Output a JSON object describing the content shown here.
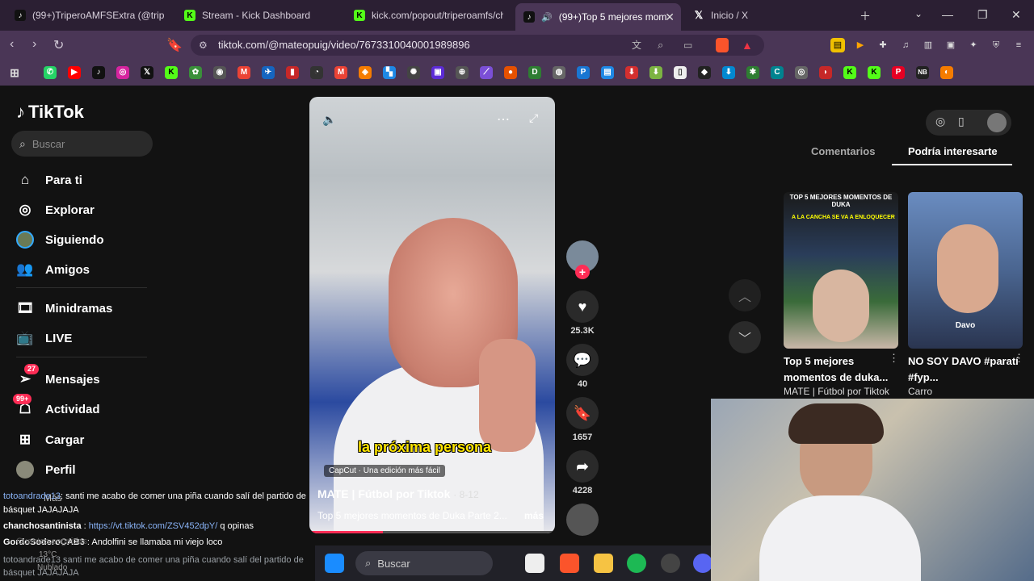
{
  "tabs": [
    {
      "title": "(99+)TriperoAMFSExtra (@tripero",
      "icon": "tiktok-icon",
      "active": false
    },
    {
      "title": "Stream - Kick Dashboard",
      "icon": "kick-icon",
      "active": false
    },
    {
      "title": "kick.com/popout/triperoamfs/ch",
      "icon": "kick-icon",
      "active": false
    },
    {
      "title": "(99+)Top 5 mejores mom",
      "icon": "tiktok-icon",
      "active": true
    },
    {
      "title": "Inicio / X",
      "icon": "x-icon",
      "active": false
    }
  ],
  "address": {
    "url": "tiktok.com/@mateopuig/video/7673310040001989896"
  },
  "tiktok": {
    "logo": "TikTok",
    "search_placeholder": "Buscar",
    "nav": {
      "para_ti": "Para ti",
      "explorar": "Explorar",
      "siguiendo": "Siguiendo",
      "amigos": "Amigos",
      "minidramas": "Minidramas",
      "live": "LIVE",
      "mensajes": "Mensajes",
      "mensajes_badge": "27",
      "actividad": "Actividad",
      "actividad_badge": "99+",
      "cargar": "Cargar",
      "perfil": "Perfil",
      "mas": "Más"
    },
    "video": {
      "caption": "la próxima persona",
      "capcut": "CapCut · Una edición más fácil",
      "author": "MATE | Fútbol por Tiktok",
      "date": "· 8-12",
      "description": "Top 5 mejores momentos de Duka Parte 2...",
      "more": "más",
      "progress": 0.3
    },
    "actions": {
      "likes": "25.3K",
      "comments": "40",
      "saves": "1657",
      "shares": "4228"
    },
    "right_tabs": {
      "comments": "Comentarios",
      "recommended": "Podría interesarte"
    },
    "recommended": [
      {
        "thumb_text": "TOP 5 MEJORES MOMENTOS DE DUKA",
        "thumb_sub": "A LA CANCHA SE VA A ENLOQUECER",
        "title": "Top 5 mejores momentos de duka...",
        "author": "MATE | Fútbol por Tiktok"
      },
      {
        "thumb_text": "Davo",
        "title": "NO SOY DAVO #paratí #fyp...",
        "author": "Carro"
      }
    ]
  },
  "chat": [
    {
      "user": "totoandrade13",
      "user_color": "#8ab4f8",
      "text": ": santi me acabo de comer una piña cuando salí del partido de"
    },
    {
      "user": "",
      "user_color": "#ffffff",
      "text": "básquet JAJAJAJA"
    },
    {
      "user": "chanchosantinista",
      "user_color": "#ffffff",
      "text": " : ",
      "link": "https://vt.tiktok.com/ZSV452dpY/",
      "after": " q opinas"
    },
    {
      "user": "GordoSoderoCAB3",
      "user_color": "#ffffff",
      "text": " : Andolfini se llamaba mi viejo loco"
    },
    {
      "user": "totoandrade13",
      "user_color": "#9aa0a6",
      "text": " santi me acabo de comer una piña cuando salí del partido de"
    },
    {
      "user": "",
      "user_color": "#9aa0a6",
      "text": "básquet JAJAJAJA"
    }
  ],
  "chat_overlay": {
    "more_label": "Cuentas seguidas",
    "weather_temp": "13°C",
    "weather_text": "Nublado"
  },
  "taskbar": {
    "search_placeholder": "Buscar"
  }
}
